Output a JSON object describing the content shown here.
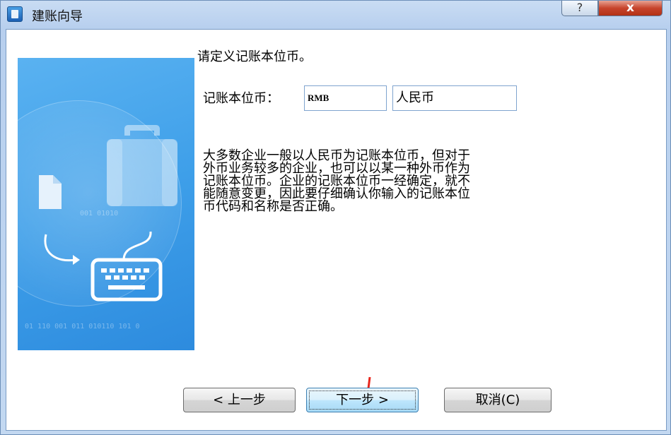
{
  "window": {
    "title": "建账向导",
    "help_label": "?",
    "close_label": "x"
  },
  "content": {
    "prompt": "请定义记账本位币。",
    "currency_label": "记账本位币：",
    "currency_code": "RMB",
    "currency_name": "人民币",
    "description_lines": [
      "大多数企业一般以人民币为记账本位币，但对于",
      "外币业务较多的企业，也可以以某一种外币作为",
      "记账本位币。企业的记账本位币一经确定，就不",
      "能随意变更，因此要仔细确认你输入的记账本位",
      "币代码和名称是否正确。"
    ]
  },
  "side_image": {
    "binary_rows": [
      "001 01010",
      "01 110 001 011 010110 101 0"
    ]
  },
  "buttons": {
    "prev_label": "< 上一步",
    "next_label": "下一步 >",
    "cancel_label": "取消(C)"
  },
  "colors": {
    "accent": "#3c7fb1",
    "arrow": "#e8261c",
    "side_bg": "#3e9fe9"
  }
}
